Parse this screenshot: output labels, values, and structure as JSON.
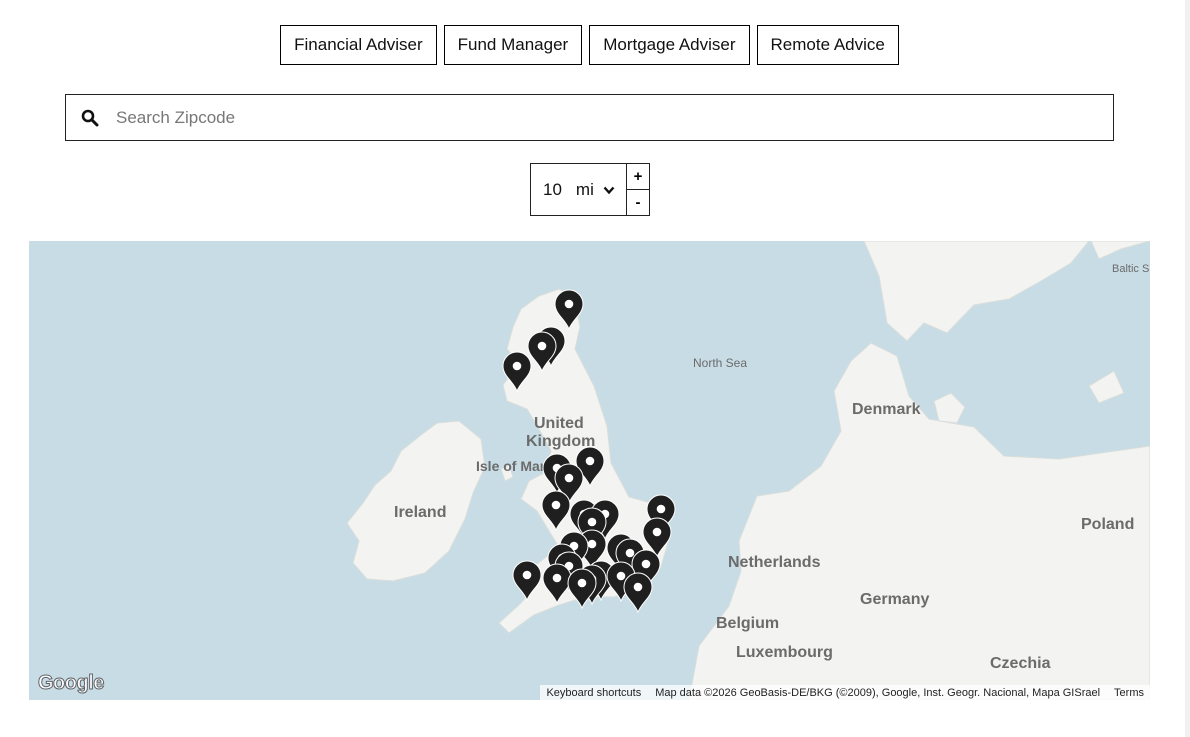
{
  "filters": [
    {
      "label": "Financial Adviser"
    },
    {
      "label": "Fund Manager"
    },
    {
      "label": "Mortgage Adviser"
    },
    {
      "label": "Remote Advice"
    }
  ],
  "search": {
    "placeholder": "Search Zipcode",
    "value": "",
    "icon": "search-icon"
  },
  "radius": {
    "value": "10",
    "unit": "mi",
    "zoom_in": "+",
    "zoom_out": "-"
  },
  "map": {
    "labels": {
      "baltic": "Baltic S",
      "north_sea": "North Sea",
      "denmark": "Denmark",
      "uk_line1": "United",
      "uk_line2": "Kingdom",
      "isle_of_man": "Isle of Man",
      "ireland": "Ireland",
      "poland": "Poland",
      "netherlands": "Netherlands",
      "germany": "Germany",
      "belgium": "Belgium",
      "luxembourg": "Luxembourg",
      "czechia": "Czechia"
    },
    "logo": "Google",
    "attribution": {
      "shortcuts": "Keyboard shortcuts",
      "data": "Map data ©2026 GeoBasis-DE/BKG (©2009), Google, Inst. Geogr. Nacional, Mapa GISrael",
      "terms": "Terms"
    },
    "colors": {
      "water": "#c8dce5",
      "land": "#f3f3f1",
      "marker": "#1f1f1f"
    }
  }
}
